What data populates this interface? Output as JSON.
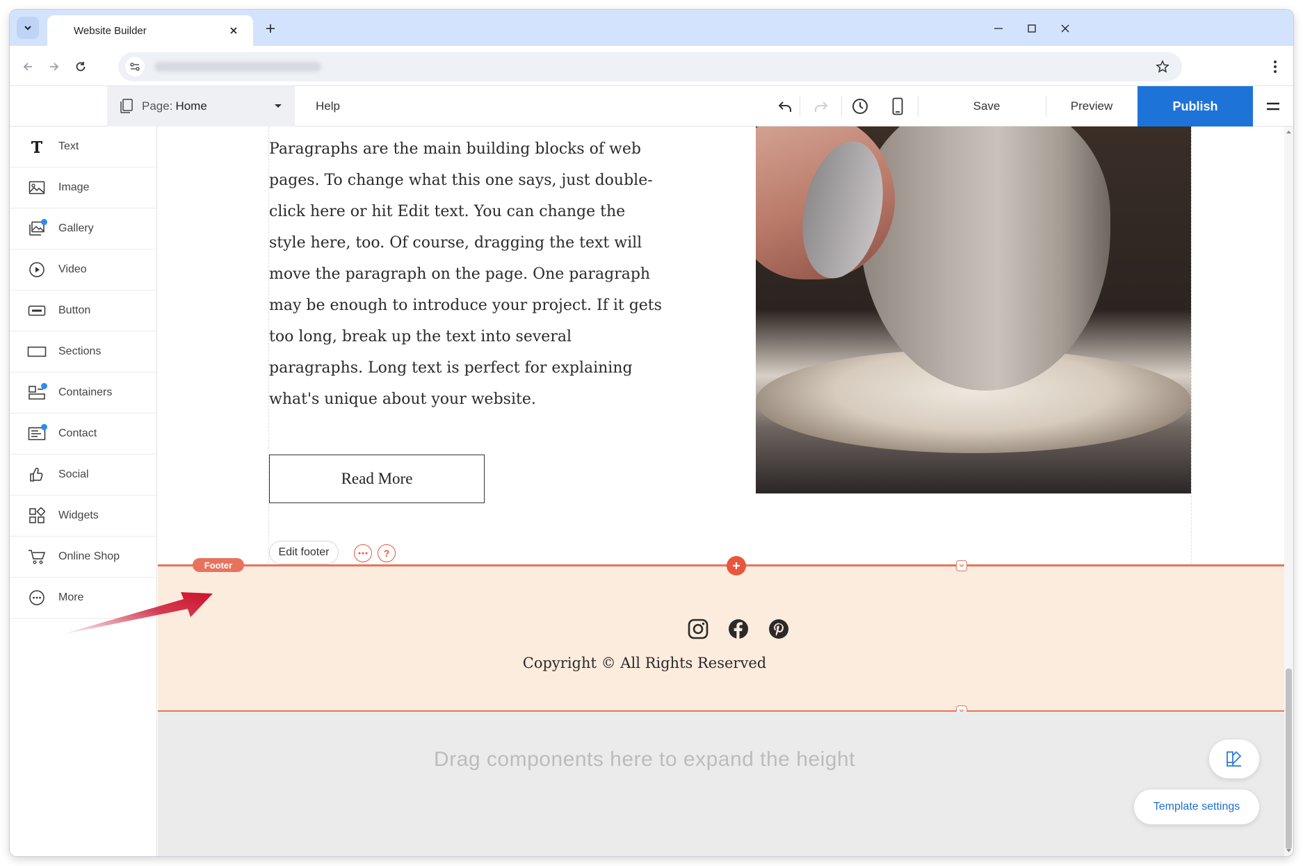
{
  "browser": {
    "tab_title": "Website Builder"
  },
  "toolbar": {
    "page_prefix": "Page:",
    "page_name": "Home",
    "help": "Help",
    "save": "Save",
    "preview": "Preview",
    "publish": "Publish",
    "publish_color": "#1d73d8"
  },
  "sidebar": {
    "items": [
      {
        "label": "Text",
        "icon": "text-icon"
      },
      {
        "label": "Image",
        "icon": "image-icon"
      },
      {
        "label": "Gallery",
        "icon": "gallery-icon"
      },
      {
        "label": "Video",
        "icon": "video-icon"
      },
      {
        "label": "Button",
        "icon": "button-icon"
      },
      {
        "label": "Sections",
        "icon": "sections-icon"
      },
      {
        "label": "Containers",
        "icon": "containers-icon"
      },
      {
        "label": "Contact",
        "icon": "contact-icon"
      },
      {
        "label": "Social",
        "icon": "social-icon"
      },
      {
        "label": "Widgets",
        "icon": "widgets-icon"
      },
      {
        "label": "Online Shop",
        "icon": "cart-icon"
      },
      {
        "label": "More",
        "icon": "more-icon"
      }
    ]
  },
  "canvas": {
    "paragraph": "Paragraphs are the main building blocks of web pages. To change what this one says, just double-click here or hit Edit text. You can change the style here, too. Of course, dragging the text will move the paragraph on the page. One paragraph may be enough to introduce your project. If it gets too long, break up the text into several paragraphs. Long text is perfect for explaining what's unique about your website.",
    "read_more": "Read More",
    "edit_footer": "Edit footer",
    "footer_tag": "Footer",
    "footer_color": "#fcecde",
    "accent_color": "#e8735c",
    "copyright": "Copyright © All Rights Reserved",
    "drop_text": "Drag components here to expand the height",
    "template_settings": "Template settings",
    "social_icons": [
      "instagram-icon",
      "facebook-icon",
      "pinterest-icon"
    ]
  }
}
